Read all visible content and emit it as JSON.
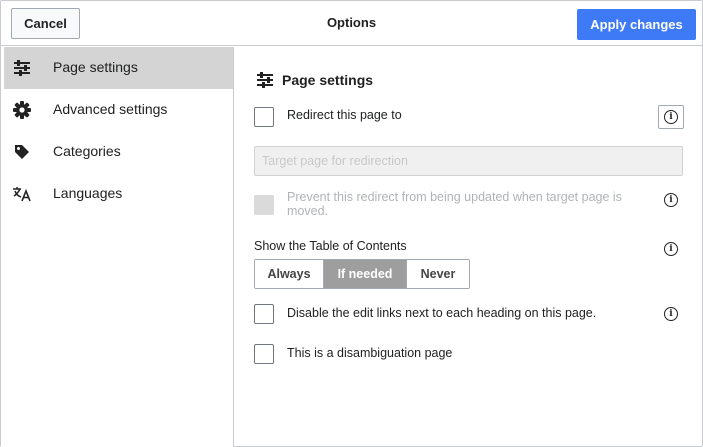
{
  "header": {
    "cancel_label": "Cancel",
    "title": "Options",
    "apply_label": "Apply changes"
  },
  "sidebar": {
    "items": [
      {
        "label": "Page settings",
        "icon": "sliders-icon",
        "selected": true
      },
      {
        "label": "Advanced settings",
        "icon": "gear-icon",
        "selected": false
      },
      {
        "label": "Categories",
        "icon": "tag-icon",
        "selected": false
      },
      {
        "label": "Languages",
        "icon": "language-icon",
        "selected": false
      }
    ]
  },
  "panel": {
    "title": "Page settings",
    "redirect": {
      "label": "Redirect this page to",
      "checked": false
    },
    "target_input": {
      "value": "",
      "placeholder": "Target page for redirection"
    },
    "prevent_redirect": {
      "label": "Prevent this redirect from being updated when target page is moved.",
      "checked": false,
      "disabled": true
    },
    "toc": {
      "label": "Show the Table of Contents",
      "options": [
        "Always",
        "If needed",
        "Never"
      ],
      "selected": "If needed"
    },
    "disable_edit_links": {
      "label": "Disable the edit links next to each heading on this page.",
      "checked": false
    },
    "disambiguation": {
      "label": "This is a disambiguation page",
      "checked": false
    }
  },
  "colors": {
    "accent": "#3e7af6",
    "selected_nav": "#d4d4d4",
    "toc_active": "#9e9e9e"
  }
}
